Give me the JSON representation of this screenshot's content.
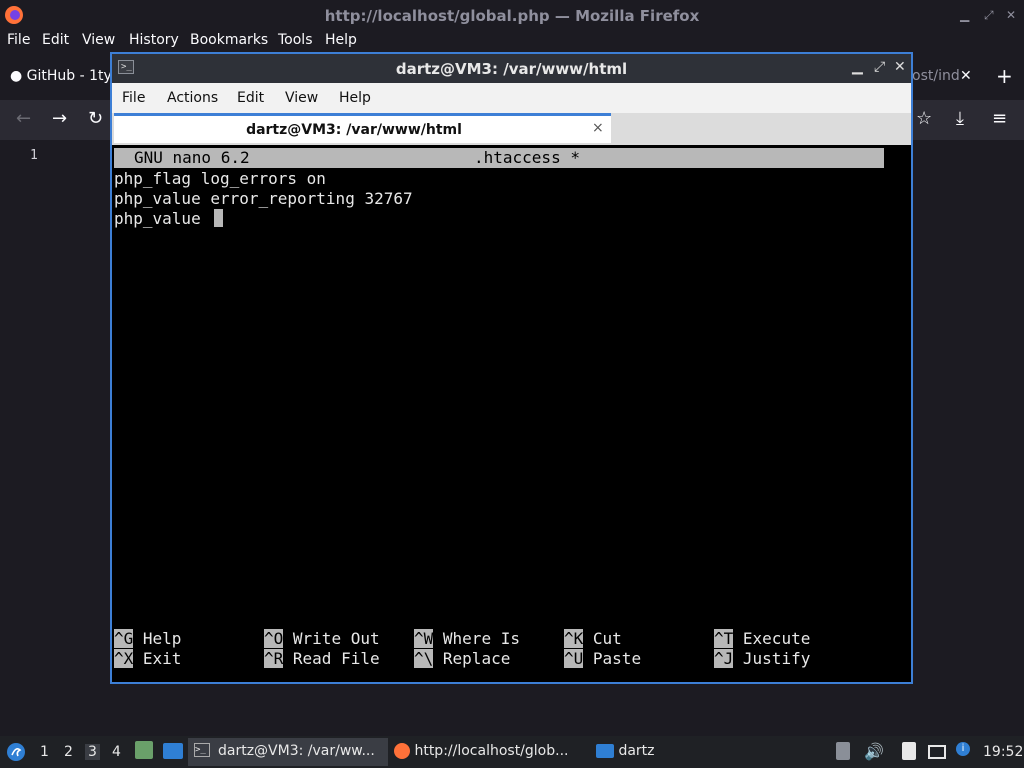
{
  "firefox": {
    "window_title": "http://localhost/global.php — Mozilla Firefox",
    "menu": [
      "File",
      "Edit",
      "View",
      "History",
      "Bookmarks",
      "Tools",
      "Help"
    ],
    "tab_github": "GitHub - 1ty",
    "tab_partial": "ost/ind",
    "line_number": "1"
  },
  "terminal": {
    "window_title": "dartz@VM3: /var/www/html",
    "menu": [
      "File",
      "Actions",
      "Edit",
      "View",
      "Help"
    ],
    "tab_label": "dartz@VM3: /var/www/html",
    "tab_close": "×"
  },
  "nano": {
    "version": "GNU nano 6.2",
    "filename": ".htaccess *",
    "lines": [
      "php_flag log_errors on",
      "php_value error_reporting 32767",
      "php_value "
    ],
    "shortcuts_row1": [
      {
        "key": "^G",
        "label": "Help"
      },
      {
        "key": "^O",
        "label": "Write Out"
      },
      {
        "key": "^W",
        "label": "Where Is"
      },
      {
        "key": "^K",
        "label": "Cut"
      },
      {
        "key": "^T",
        "label": "Execute"
      }
    ],
    "shortcuts_row2": [
      {
        "key": "^X",
        "label": "Exit"
      },
      {
        "key": "^R",
        "label": "Read File"
      },
      {
        "key": "^\\",
        "label": "Replace"
      },
      {
        "key": "^U",
        "label": "Paste"
      },
      {
        "key": "^J",
        "label": "Justify"
      }
    ]
  },
  "taskbar": {
    "workspaces": [
      "1",
      "2",
      "3",
      "4"
    ],
    "tasks": [
      "dartz@VM3: /var/ww...",
      "http://localhost/glob...",
      "dartz"
    ],
    "clock": "19:52"
  },
  "colors": {
    "accent": "#3d7fd6",
    "terminal_bg": "#000000",
    "nano_bar": "#b8b8b8"
  }
}
